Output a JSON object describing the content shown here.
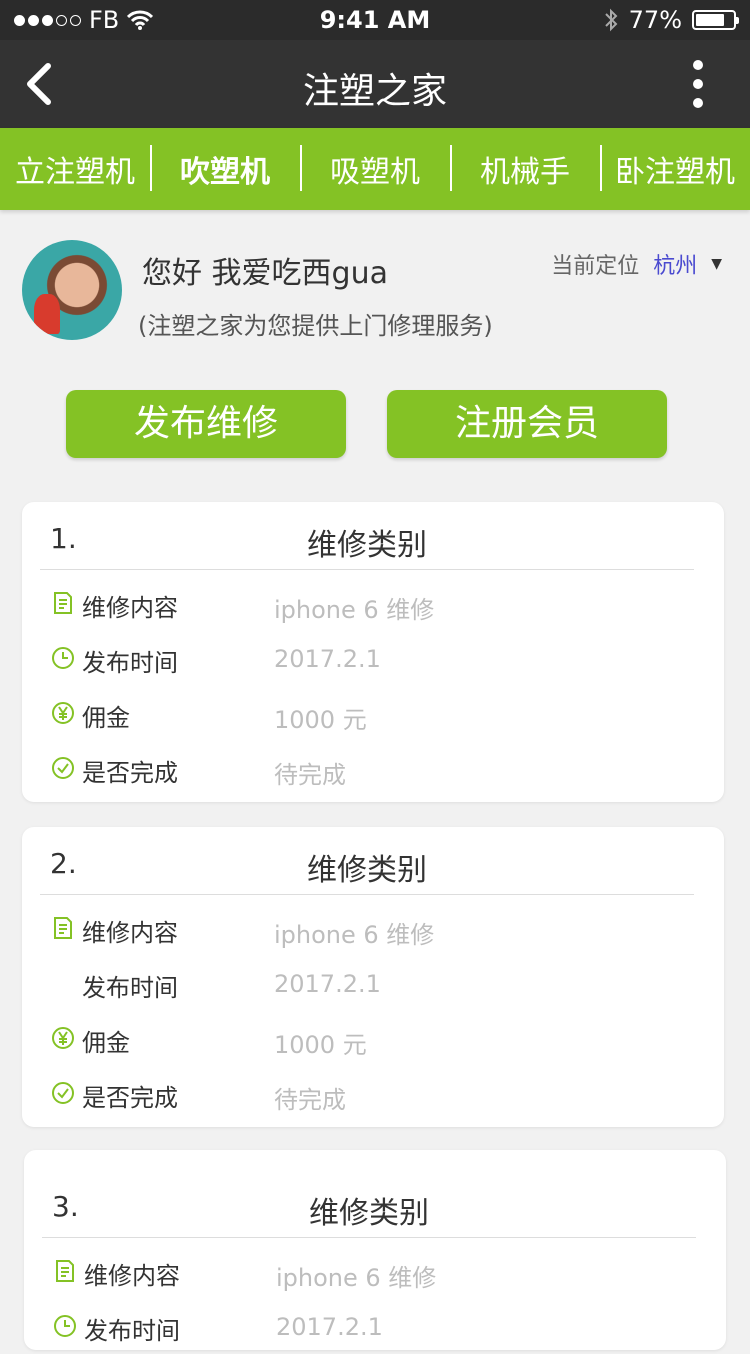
{
  "status_bar": {
    "carrier": "FB",
    "time": "9:41 AM",
    "battery": "77%",
    "battery_level": 0.77
  },
  "nav": {
    "title": "注塑之家"
  },
  "tabs": [
    {
      "label": "立注塑机"
    },
    {
      "label": "吹塑机",
      "active": true
    },
    {
      "label": "吸塑机"
    },
    {
      "label": "机械手"
    },
    {
      "label": "卧注塑机"
    }
  ],
  "profile": {
    "greeting": "您好 我爱吃西gua",
    "subtitle": "(注塑之家为您提供上门修理服务)",
    "location_label": "当前定位",
    "city": "杭州"
  },
  "actions": {
    "repair_label": "发布维修",
    "register_label": "注册会员"
  },
  "cards": [
    {
      "num": "1.",
      "title": "维修类别",
      "rows": [
        {
          "icon": "document-icon",
          "label": "维修内容",
          "value": "iphone 6 维修"
        },
        {
          "icon": "clock-icon",
          "label": "发布时间",
          "value": "2017.2.1"
        },
        {
          "icon": "yen-icon",
          "label": "佣金",
          "value": "1000 元"
        },
        {
          "icon": "check-circle-icon",
          "label": "是否完成",
          "value": "待完成"
        }
      ]
    },
    {
      "num": "2.",
      "title": "维修类别",
      "rows": [
        {
          "icon": "document-icon",
          "label": "维修内容",
          "value": "iphone 6 维修"
        },
        {
          "icon": "",
          "label": "发布时间",
          "value": "2017.2.1"
        },
        {
          "icon": "yen-icon",
          "label": "佣金",
          "value": "1000 元"
        },
        {
          "icon": "check-circle-icon",
          "label": "是否完成",
          "value": "待完成"
        }
      ]
    },
    {
      "num": "3.",
      "title": "维修类别",
      "rows": [
        {
          "icon": "document-icon",
          "label": "维修内容",
          "value": "iphone 6 维修"
        },
        {
          "icon": "clock-icon",
          "label": "发布时间",
          "value": "2017.2.1"
        }
      ]
    }
  ],
  "colors": {
    "accent": "#84c225",
    "navbar": "#333333",
    "statusbar": "#2b2b2b",
    "city": "#4a4ad0"
  }
}
